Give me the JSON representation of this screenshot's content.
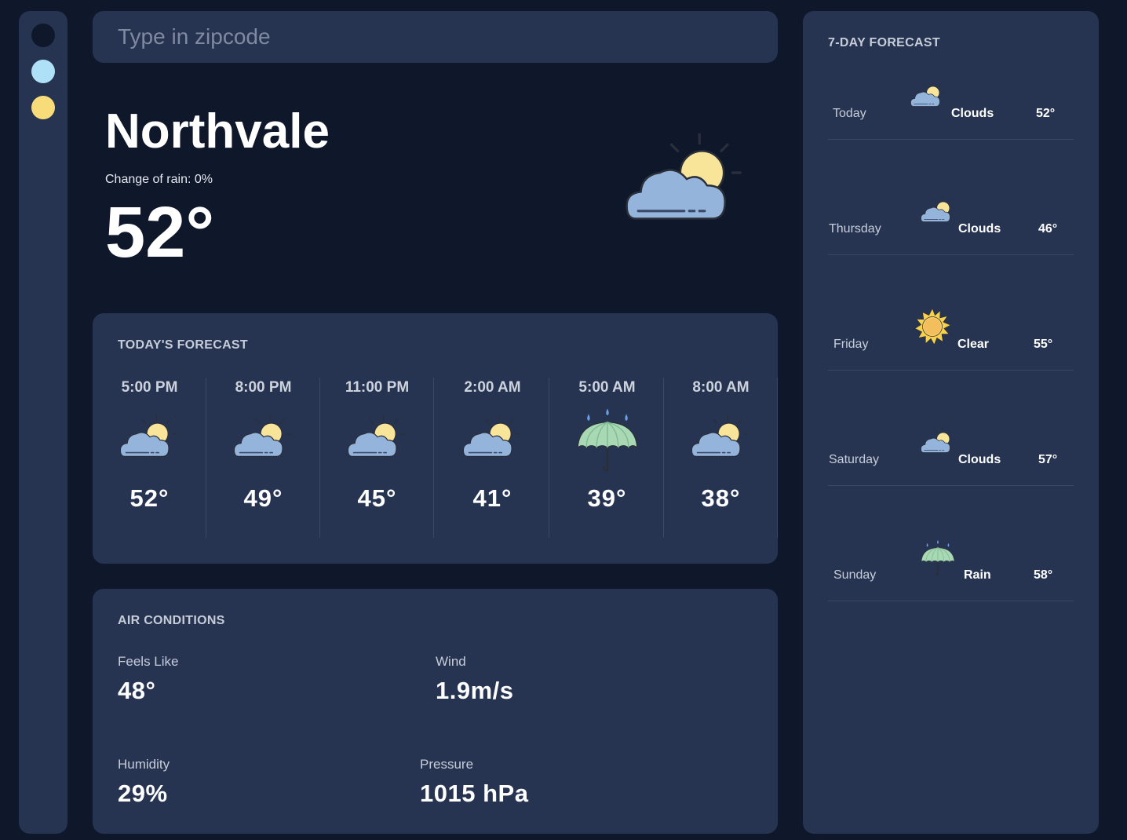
{
  "search": {
    "placeholder": "Type in zipcode"
  },
  "theme_colors": [
    "#0f172a",
    "#aee0f8",
    "#f9dc7a"
  ],
  "current": {
    "city": "Northvale",
    "rain_chance": "Change of rain: 0%",
    "temperature": "52°",
    "icon": "cloud-sun-icon"
  },
  "todays_forecast": {
    "title": "TODAY'S FORECAST",
    "hours": [
      {
        "time": "5:00 PM",
        "icon": "cloud-sun-icon",
        "temp": "52°"
      },
      {
        "time": "8:00 PM",
        "icon": "cloud-sun-icon",
        "temp": "49°"
      },
      {
        "time": "11:00 PM",
        "icon": "cloud-sun-icon",
        "temp": "45°"
      },
      {
        "time": "2:00 AM",
        "icon": "cloud-sun-icon",
        "temp": "41°"
      },
      {
        "time": "5:00 AM",
        "icon": "umbrella-rain-icon",
        "temp": "39°"
      },
      {
        "time": "8:00 AM",
        "icon": "cloud-sun-icon",
        "temp": "38°"
      }
    ]
  },
  "air_conditions": {
    "title": "AIR CONDITIONS",
    "feels_like": {
      "label": "Feels Like",
      "value": "48°"
    },
    "wind": {
      "label": "Wind",
      "value": "1.9m/s"
    },
    "humidity": {
      "label": "Humidity",
      "value": "29%"
    },
    "pressure": {
      "label": "Pressure",
      "value": "1015 hPa"
    }
  },
  "weekly": {
    "title": "7-DAY FORECAST",
    "days": [
      {
        "day": "Today",
        "icon": "cloud-sun-icon",
        "condition": "Clouds",
        "temp": "52°"
      },
      {
        "day": "Thursday",
        "icon": "cloud-sun-icon",
        "condition": "Clouds",
        "temp": "46°"
      },
      {
        "day": "Friday",
        "icon": "sun-icon",
        "condition": "Clear",
        "temp": "55°"
      },
      {
        "day": "Saturday",
        "icon": "cloud-sun-icon",
        "condition": "Clouds",
        "temp": "57°"
      },
      {
        "day": "Sunday",
        "icon": "umbrella-rain-icon",
        "condition": "Rain",
        "temp": "58°"
      }
    ]
  },
  "colors": {
    "background": "#0f172a",
    "panel": "#263452",
    "cloud": "#94b4dc",
    "sun": "#f9e59a",
    "umbrella": "#a8d8b4",
    "raindrop": "#6a9ee6"
  }
}
